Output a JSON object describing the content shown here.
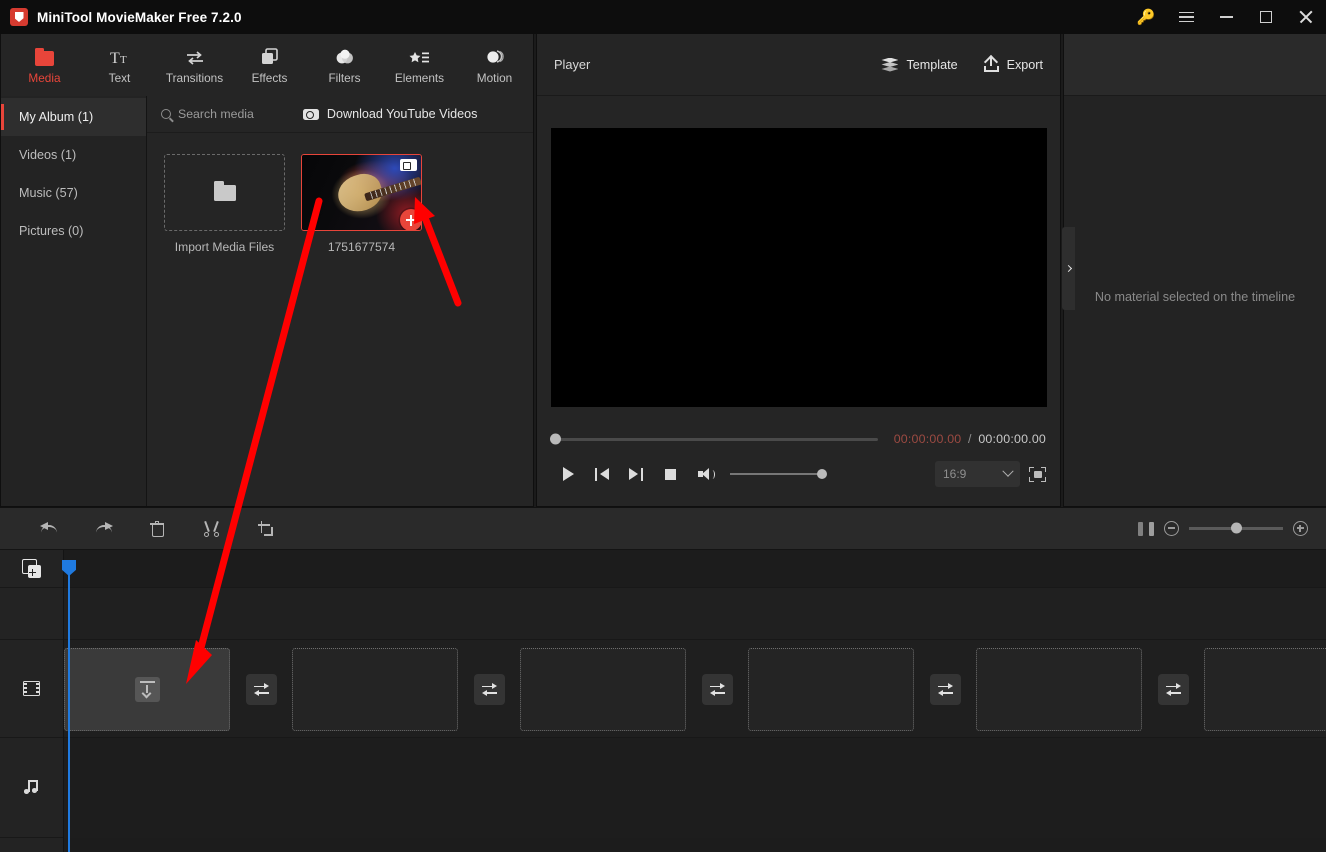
{
  "window": {
    "title": "MiniTool MovieMaker Free 7.2.0",
    "controls": {
      "key": "key-icon",
      "menu": "menu-icon",
      "minimize": "minimize",
      "maximize": "maximize",
      "close": "close"
    }
  },
  "toolbar": {
    "items": [
      {
        "label": "Media",
        "icon": "folder-icon",
        "active": true
      },
      {
        "label": "Text",
        "icon": "text-icon",
        "active": false
      },
      {
        "label": "Transitions",
        "icon": "transitions-icon",
        "active": false
      },
      {
        "label": "Effects",
        "icon": "effects-icon",
        "active": false
      },
      {
        "label": "Filters",
        "icon": "filters-icon",
        "active": false
      },
      {
        "label": "Elements",
        "icon": "elements-icon",
        "active": false
      },
      {
        "label": "Motion",
        "icon": "motion-icon",
        "active": false
      }
    ]
  },
  "library": {
    "sidebar": [
      {
        "label": "My Album (1)",
        "active": true
      },
      {
        "label": "Videos (1)",
        "active": false
      },
      {
        "label": "Music (57)",
        "active": false
      },
      {
        "label": "Pictures (0)",
        "active": false
      }
    ],
    "search_placeholder": "Search media",
    "download_youtube_label": "Download YouTube Videos",
    "import_label": "Import Media Files",
    "media_items": [
      {
        "name": "1751677574",
        "type": "video",
        "selected": true
      }
    ]
  },
  "player": {
    "title": "Player",
    "template_label": "Template",
    "export_label": "Export",
    "current_time": "00:00:00.00",
    "separator": "/",
    "total_time": "00:00:00.00",
    "aspect_ratio": "16:9",
    "seek_percent": 0,
    "volume_percent": 100
  },
  "properties": {
    "empty_message": "No material selected on the timeline"
  },
  "timeline_toolbar": {
    "buttons": [
      {
        "name": "undo",
        "icon": "undo-icon"
      },
      {
        "name": "redo",
        "icon": "redo-icon"
      },
      {
        "name": "delete",
        "icon": "trash-icon"
      },
      {
        "name": "split",
        "icon": "scissors-icon"
      },
      {
        "name": "crop",
        "icon": "crop-icon"
      }
    ],
    "zoom_percent": 45
  },
  "timeline": {
    "tracks": [
      {
        "name": "add-track",
        "icon": "add-track-icon"
      },
      {
        "name": "overlay-track",
        "icon": ""
      },
      {
        "name": "video-track",
        "icon": "film-icon"
      },
      {
        "name": "audio-track",
        "icon": "music-icon"
      }
    ],
    "clips": [
      {
        "state": "filled",
        "icon": "drop-here-icon"
      },
      {
        "state": "empty",
        "icon": ""
      },
      {
        "state": "empty",
        "icon": ""
      },
      {
        "state": "empty",
        "icon": ""
      },
      {
        "state": "empty",
        "icon": ""
      },
      {
        "state": "empty",
        "icon": ""
      }
    ],
    "transition_slots": 5,
    "playhead_position": "00:00:00.00"
  },
  "colors": {
    "accent": "#e8453a",
    "annotation": "#ff0000",
    "playhead": "#1f7ae0",
    "key": "#e8b024"
  }
}
